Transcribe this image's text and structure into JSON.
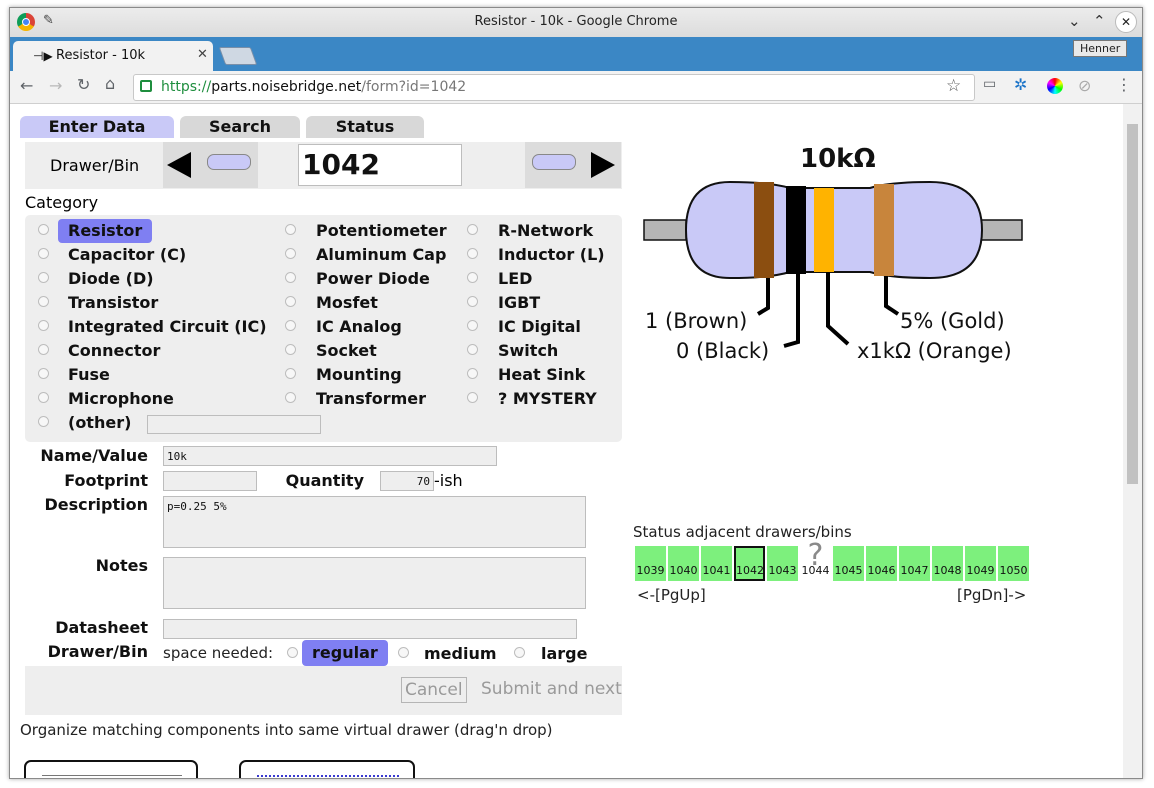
{
  "window": {
    "title": "Resistor - 10k - Google Chrome",
    "profile": "Henner"
  },
  "tab": {
    "label": "Resistor - 10k"
  },
  "address": {
    "scheme": "https://",
    "host": "parts.noisebridge.net",
    "path": "/form?id=1042"
  },
  "nav_tabs": [
    "Enter Data",
    "Search",
    "Status"
  ],
  "drawer_bin": {
    "label": "Drawer/Bin",
    "value": "1042"
  },
  "category": {
    "label": "Category",
    "options": [
      "Resistor",
      "Potentiometer",
      "R-Network",
      "Capacitor (C)",
      "Aluminum Cap",
      "Inductor (L)",
      "Diode (D)",
      "Power Diode",
      "LED",
      "Transistor",
      "Mosfet",
      "IGBT",
      "Integrated Circuit (IC)",
      "IC Analog",
      "IC Digital",
      "Connector",
      "Socket",
      "Switch",
      "Fuse",
      "Mounting",
      "Heat Sink",
      "Microphone",
      "Transformer",
      "? MYSTERY",
      "(other)"
    ],
    "selected": "Resistor",
    "other_value": ""
  },
  "form": {
    "name_label": "Name/Value",
    "name_value": "10k",
    "footprint_label": "Footprint",
    "footprint_value": "",
    "quantity_label": "Quantity",
    "quantity_value": "70",
    "quantity_suffix": "-ish",
    "description_label": "Description",
    "description_value": "p=0.25 5%",
    "notes_label": "Notes",
    "notes_value": "",
    "datasheet_label": "Datasheet",
    "datasheet_value": "",
    "drawerbin_label": "Drawer/Bin",
    "space_label": "space needed:",
    "space_options": [
      "regular",
      "medium",
      "large"
    ],
    "space_selected": "regular",
    "cancel_label": "Cancel",
    "submit_label": "Submit and next"
  },
  "organize_text": "Organize matching components into same virtual drawer (drag'n drop)",
  "resistor": {
    "value_text": "10kΩ",
    "bands": [
      {
        "label": "1 (Brown)",
        "color": "#8b4e10"
      },
      {
        "label": "0 (Black)",
        "color": "#000000"
      },
      {
        "label": "x1kΩ (Orange)",
        "color": "#ffb300"
      },
      {
        "label": "5% (Gold)",
        "color": "#c8853c"
      }
    ],
    "body_color": "#c9c9f7"
  },
  "status": {
    "label": "Status adjacent drawers/bins",
    "bins": [
      {
        "id": "1039",
        "state": "filled"
      },
      {
        "id": "1040",
        "state": "filled"
      },
      {
        "id": "1041",
        "state": "filled"
      },
      {
        "id": "1042",
        "state": "current"
      },
      {
        "id": "1043",
        "state": "filled"
      },
      {
        "id": "1044",
        "state": "unknown"
      },
      {
        "id": "1045",
        "state": "filled"
      },
      {
        "id": "1046",
        "state": "filled"
      },
      {
        "id": "1047",
        "state": "filled"
      },
      {
        "id": "1048",
        "state": "filled"
      },
      {
        "id": "1049",
        "state": "filled"
      },
      {
        "id": "1050",
        "state": "filled"
      }
    ],
    "unknown_glyph": "?",
    "pgup": "<-[PgUp]",
    "pgdn": "[PgDn]->"
  },
  "colors": {
    "accent": "#7f7ff2",
    "selected_tab": "#c9c9f7",
    "bin_green": "#7df07d",
    "chrome_tab_strip": "#3b87c5"
  }
}
